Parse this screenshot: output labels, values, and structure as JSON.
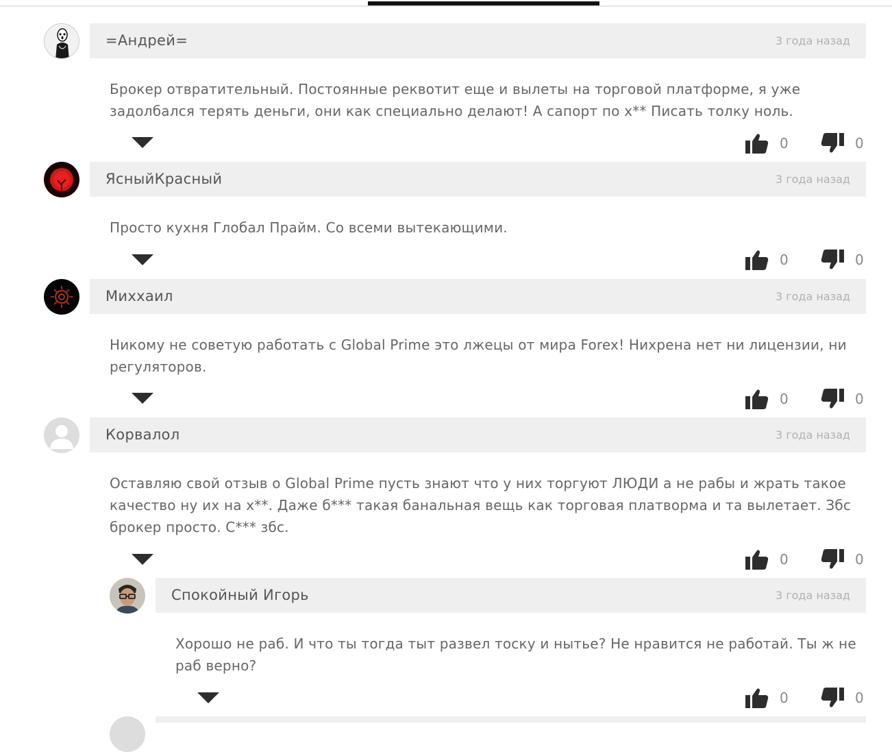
{
  "comments": [
    {
      "author": "=Андрей=",
      "time": "3 года назад",
      "text": "Брокер отвратительный. Постоянные реквотит еще и вылеты на торговой платформе, я уже задолбался терять деньги, они как специально делают! А сапорт по х** Писать толку ноль.",
      "likes": "0",
      "dislikes": "0"
    },
    {
      "author": "ЯсныйКрасный",
      "time": "3 года назад",
      "text": "Просто кухня Глобал Прайм. Со всеми вытекающими.",
      "likes": "0",
      "dislikes": "0"
    },
    {
      "author": "Михxаил",
      "time": "3 года назад",
      "text": "Никому не советую работать с Global Prime это лжецы от мира Forex! Нихрена нет ни лицензии, ни регуляторов.",
      "likes": "0",
      "dislikes": "0"
    },
    {
      "author": "Корвалол",
      "time": "3 года назад",
      "text": "Оставляю свой отзыв о Global Prime пусть знают что у них торгуют ЛЮДИ а не рабы и жрать такое качество ну их на х**. Даже б*** такая банальная вещь как торговая платворма и та вылетает. Збс брокер просто. С*** збс.",
      "likes": "0",
      "dislikes": "0"
    },
    {
      "author": "Спокойный Игорь",
      "time": "3 года назад",
      "text": "Хорошо не раб. И что ты тогда тыт развел тоску и нытье? Не нравится не работай. Ты ж не раб верно?",
      "likes": "0",
      "dislikes": "0"
    }
  ],
  "colors": {
    "header_bg": "#efefef",
    "text": "#666666",
    "muted": "#b0b0b0",
    "icon": "#2d2d2d"
  },
  "icons": {
    "like": "thumbs-up-icon",
    "dislike": "thumbs-down-icon",
    "collapse": "triangle-down-icon"
  }
}
